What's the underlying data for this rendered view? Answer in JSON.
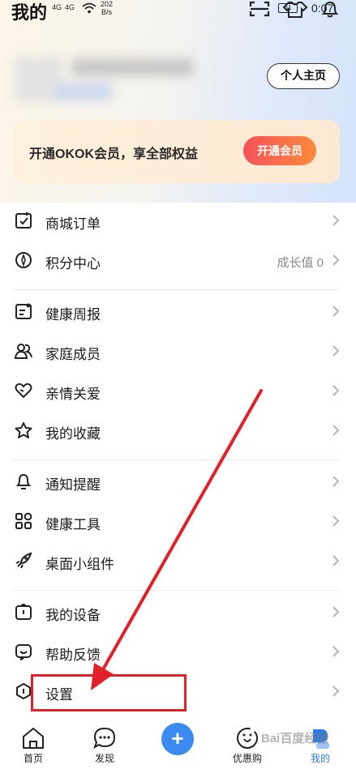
{
  "page": {
    "title": "我的"
  },
  "status_bar": {
    "signal1": "4G",
    "signal2": "4G",
    "speed_value": "202",
    "speed_unit": "B/s",
    "battery": "61",
    "time": "0:07"
  },
  "profile": {
    "homepage_label": "个人主页"
  },
  "vip": {
    "text": "开通OKOK会员，享全部权益",
    "button_label": "开通会员"
  },
  "menu": [
    {
      "label": "商城订单",
      "value": "",
      "icon": "receipt-icon"
    },
    {
      "label": "积分中心",
      "value": "成长值 0",
      "icon": "points-icon"
    },
    {
      "label": "健康周报",
      "value": "",
      "icon": "report-icon"
    },
    {
      "label": "家庭成员",
      "value": "",
      "icon": "family-icon"
    },
    {
      "label": "亲情关爱",
      "value": "",
      "icon": "heart-icon"
    },
    {
      "label": "我的收藏",
      "value": "",
      "icon": "star-icon"
    },
    {
      "label": "通知提醒",
      "value": "",
      "icon": "bell-icon"
    },
    {
      "label": "健康工具",
      "value": "",
      "icon": "grid-icon"
    },
    {
      "label": "桌面小组件",
      "value": "",
      "icon": "rocket-icon"
    },
    {
      "label": "我的设备",
      "value": "",
      "icon": "device-icon"
    },
    {
      "label": "帮助反馈",
      "value": "",
      "icon": "smile-chat-icon"
    },
    {
      "label": "设置",
      "value": "",
      "icon": "settings-hex-icon"
    }
  ],
  "tabs": [
    {
      "label": "首页",
      "icon": "home-icon"
    },
    {
      "label": "发现",
      "icon": "chat-bubble-icon"
    },
    {
      "label": "",
      "icon": "plus-icon"
    },
    {
      "label": "优惠购",
      "icon": "coupon-icon"
    },
    {
      "label": "我的",
      "icon": "profile-icon"
    }
  ],
  "watermark": "Bai百度经验",
  "colors": {
    "accent": "#2a7de8",
    "vip_start": "#f5525a",
    "vip_end": "#fd8a3c",
    "annotation": "#e3202a"
  }
}
